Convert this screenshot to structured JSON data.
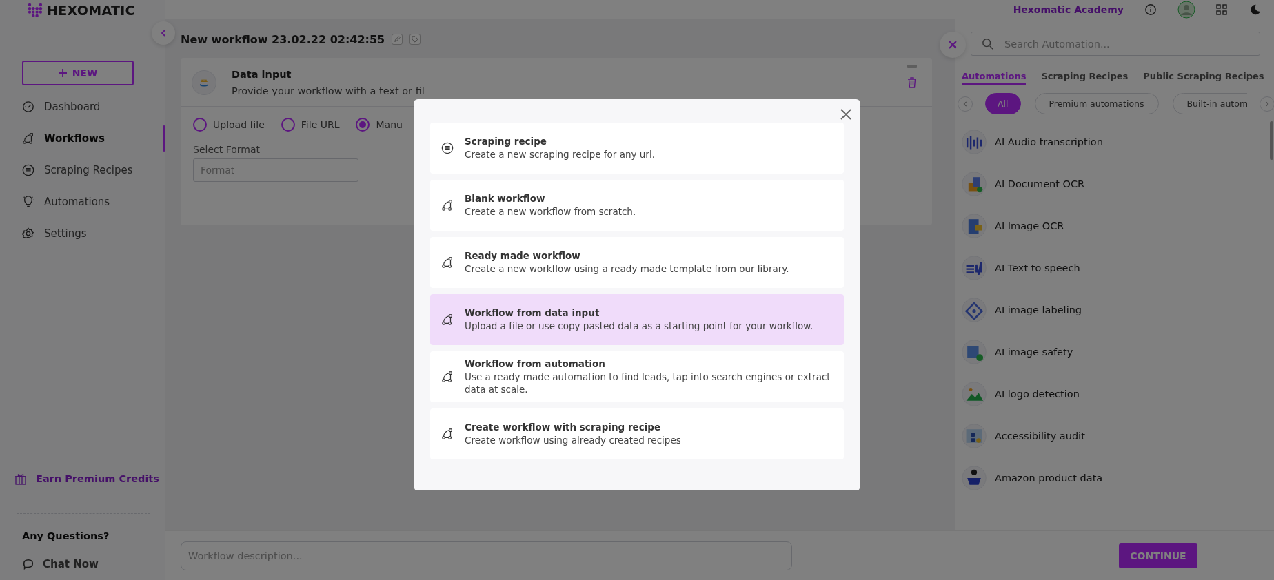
{
  "logo": {
    "text": "HEXOMATIC"
  },
  "header": {
    "academy_link": "Hexomatic Academy"
  },
  "sidebar": {
    "new_button": "NEW",
    "items": [
      {
        "label": "Dashboard",
        "selected": false
      },
      {
        "label": "Workflows",
        "selected": true
      },
      {
        "label": "Scraping Recipes",
        "selected": false
      },
      {
        "label": "Automations",
        "selected": false
      },
      {
        "label": "Settings",
        "selected": false
      }
    ],
    "earn_credits": "Earn Premium Credits",
    "help_title": "Any Questions?",
    "chat_link": "Chat Now"
  },
  "workflow": {
    "title": "New workflow 23.02.22 02:42:55",
    "step": {
      "title": "Data input",
      "description": "Provide your workflow with a text or fil",
      "sources": [
        {
          "label": "Upload file",
          "selected": false
        },
        {
          "label": "File URL",
          "selected": false
        },
        {
          "label": "Manu",
          "selected": true
        }
      ],
      "format": {
        "label": "Select Format",
        "placeholder": "Format"
      }
    },
    "description": {
      "placeholder": "Workflow description..."
    },
    "continue_button": "CONTINUE"
  },
  "panel": {
    "search": {
      "placeholder": "Search Automation..."
    },
    "tabs": [
      {
        "label": "Automations",
        "selected": true
      },
      {
        "label": "Scraping Recipes",
        "selected": false
      },
      {
        "label": "Public Scraping Recipes",
        "selected": false
      }
    ],
    "filters": [
      {
        "label": "All",
        "selected": true
      },
      {
        "label": "Premium automations",
        "selected": false
      },
      {
        "label": "Built-in autom",
        "selected": false
      }
    ],
    "automations": [
      "AI Audio transcription",
      "AI Document OCR",
      "AI Image OCR",
      "AI Text to speech",
      "AI image labeling",
      "AI image safety",
      "AI logo detection",
      "Accessibility audit",
      "Amazon product data"
    ]
  },
  "modal": {
    "options": [
      {
        "kind": "recipe",
        "title": "Scraping recipe",
        "description": "Create a new scraping recipe for any url.",
        "selected": false
      },
      {
        "kind": "workflow",
        "title": "Blank workflow",
        "description": "Create a new workflow from scratch.",
        "selected": false
      },
      {
        "kind": "workflow",
        "title": "Ready made workflow",
        "description": "Create a new workflow using a ready made template from our library.",
        "selected": false
      },
      {
        "kind": "workflow",
        "title": "Workflow from data input",
        "description": "Upload a file or use copy pasted data as a starting point for your workflow.",
        "selected": true
      },
      {
        "kind": "workflow",
        "title": "Workflow from automation",
        "description": "Use a ready made automation to find leads, tap into search engines or extract data at scale.",
        "selected": false
      },
      {
        "kind": "workflow",
        "title": "Create workflow with scraping recipe",
        "description": "Create workflow using already created recipes",
        "selected": false
      }
    ]
  }
}
